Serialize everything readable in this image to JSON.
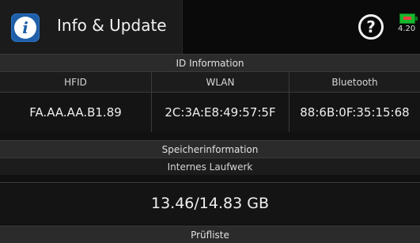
{
  "header": {
    "title": "Info & Update",
    "info_icon_glyph": "i",
    "help_icon_glyph": "?",
    "battery_voltage": "4.20",
    "colors": {
      "info_icon_bg": "#1f5fa8",
      "battery_green": "#18b82e",
      "battery_red": "#f23b3b"
    }
  },
  "id_section": {
    "title": "ID Information",
    "columns": [
      {
        "label": "HFID",
        "value": "FA.AA.AA.B1.89"
      },
      {
        "label": "WLAN",
        "value": "2C:3A:E8:49:57:5F"
      },
      {
        "label": "Bluetooth",
        "value": "88:6B:0F:35:15:68"
      }
    ]
  },
  "storage_section": {
    "title": "Speicherinformation",
    "drive_label": "Internes Laufwerk",
    "drive_value": "13.46/14.83 GB"
  },
  "checklist_section": {
    "title": "Prüfliste"
  }
}
